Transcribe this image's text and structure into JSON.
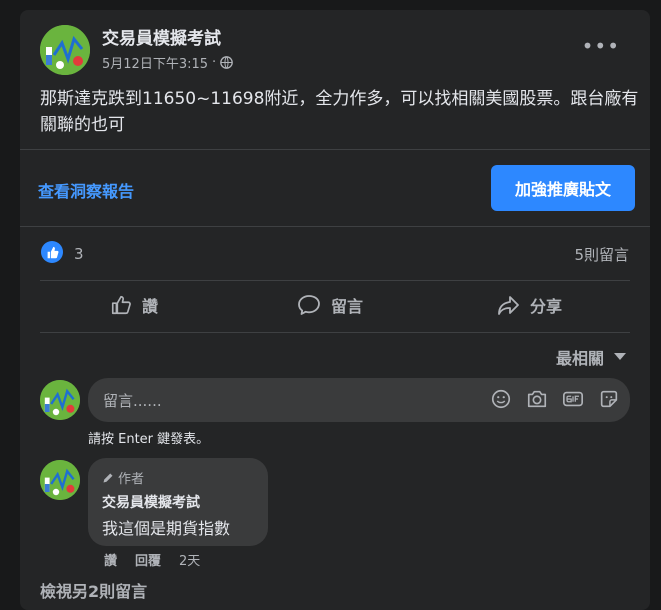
{
  "post": {
    "author": "交易員模擬考試",
    "timestamp": "5月12日下午3:15",
    "separator": "·",
    "audience_icon": "globe-icon",
    "more_label": "•••",
    "text": "那斯達克跌到11650~11698附近，全力作多，可以找相關美國股票。跟台廠有關聯的也可"
  },
  "promo": {
    "insights_label": "查看洞察報告",
    "boost_label": "加強推廣貼文"
  },
  "reactions": {
    "like_count": "3",
    "comment_count": "5則留言"
  },
  "actions": {
    "like_label": "讚",
    "comment_label": "留言",
    "share_label": "分享"
  },
  "sort": {
    "label": "最相關"
  },
  "composer": {
    "placeholder": "留言......",
    "hint": "請按 Enter 鍵發表。",
    "icons": [
      "emoji-icon",
      "camera-icon",
      "gif-icon",
      "sticker-icon"
    ]
  },
  "reply": {
    "badge": "作者",
    "name": "交易員模擬考試",
    "text": "我這個是期貨指數",
    "like_label": "讚",
    "reply_label": "回覆",
    "age": "2天"
  },
  "view_more": "檢視另2則留言",
  "colors": {
    "background": "#18191a",
    "card": "#242526",
    "accent": "#2d88ff",
    "link": "#4599ff"
  }
}
